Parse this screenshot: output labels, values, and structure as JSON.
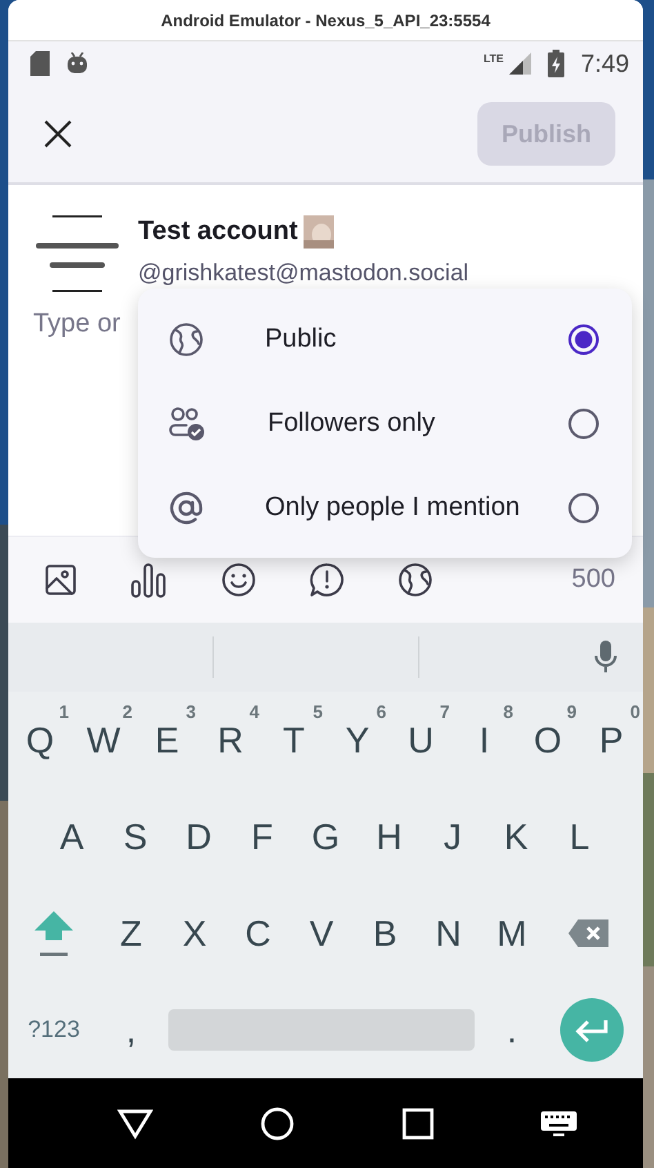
{
  "window": {
    "title": "Android Emulator - Nexus_5_API_23:5554"
  },
  "status_bar": {
    "network": "LTE",
    "time": "7:49"
  },
  "toolbar": {
    "publish_button": {
      "label": "Publish",
      "disabled": true
    }
  },
  "account": {
    "name": "Test account",
    "handle": "@grishkatest@mastodon.social"
  },
  "compose": {
    "placeholder": "Type or"
  },
  "compose_toolbar": {
    "counter": "500"
  },
  "visibility_options": [
    {
      "kind": "globe",
      "label": "Public",
      "selected": true
    },
    {
      "kind": "followers",
      "label": "Followers only",
      "selected": false
    },
    {
      "kind": "mention",
      "label": "Only people I mention",
      "selected": false
    }
  ],
  "keyboard": {
    "rows": [
      [
        {
          "kind": "letter",
          "label": "Q",
          "hint": "1"
        },
        {
          "kind": "letter",
          "label": "W",
          "hint": "2"
        },
        {
          "kind": "letter",
          "label": "E",
          "hint": "3"
        },
        {
          "kind": "letter",
          "label": "R",
          "hint": "4"
        },
        {
          "kind": "letter",
          "label": "T",
          "hint": "5"
        },
        {
          "kind": "letter",
          "label": "Y",
          "hint": "6"
        },
        {
          "kind": "letter",
          "label": "U",
          "hint": "7"
        },
        {
          "kind": "letter",
          "label": "I",
          "hint": "8"
        },
        {
          "kind": "letter",
          "label": "O",
          "hint": "9"
        },
        {
          "kind": "letter",
          "label": "P",
          "hint": "0"
        }
      ],
      [
        {
          "kind": "letter",
          "label": "A"
        },
        {
          "kind": "letter",
          "label": "S"
        },
        {
          "kind": "letter",
          "label": "D"
        },
        {
          "kind": "letter",
          "label": "F"
        },
        {
          "kind": "letter",
          "label": "G"
        },
        {
          "kind": "letter",
          "label": "H"
        },
        {
          "kind": "letter",
          "label": "J"
        },
        {
          "kind": "letter",
          "label": "K"
        },
        {
          "kind": "letter",
          "label": "L"
        }
      ],
      [
        {
          "kind": "shift"
        },
        {
          "kind": "letter",
          "label": "Z"
        },
        {
          "kind": "letter",
          "label": "X"
        },
        {
          "kind": "letter",
          "label": "C"
        },
        {
          "kind": "letter",
          "label": "V"
        },
        {
          "kind": "letter",
          "label": "B"
        },
        {
          "kind": "letter",
          "label": "N"
        },
        {
          "kind": "letter",
          "label": "M"
        },
        {
          "kind": "backspace"
        }
      ]
    ],
    "bottom_row": [
      {
        "kind": "symbols",
        "label": "?123"
      },
      {
        "kind": "letter",
        "label": ","
      },
      {
        "kind": "space"
      },
      {
        "kind": "letter",
        "label": "."
      },
      {
        "kind": "enter"
      }
    ]
  }
}
